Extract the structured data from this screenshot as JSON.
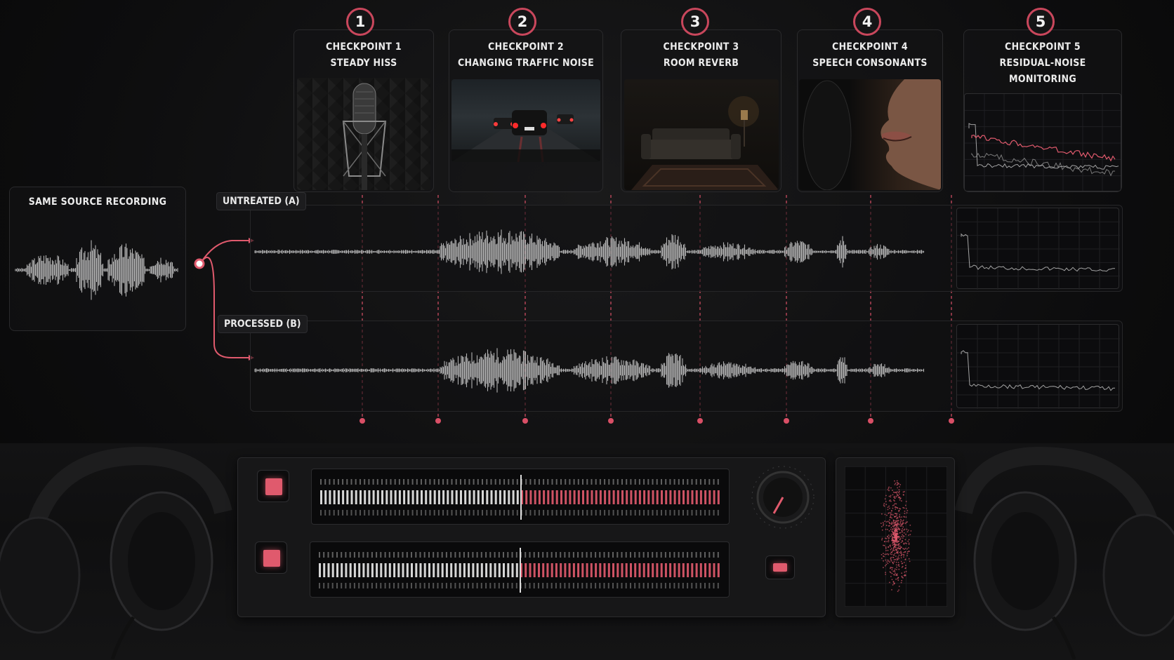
{
  "checkpoints": [
    {
      "number": "1",
      "line1": "CHECKPOINT 1",
      "line2": "STEADY HISS",
      "line3": ""
    },
    {
      "number": "2",
      "line1": "CHECKPOINT 2",
      "line2": "CHANGING TRAFFIC NOISE",
      "line3": ""
    },
    {
      "number": "3",
      "line1": "CHECKPOINT 3",
      "line2": "ROOM REVERB",
      "line3": ""
    },
    {
      "number": "4",
      "line1": "CHECKPOINT 4",
      "line2": "SPEECH CONSONANTS",
      "line3": ""
    },
    {
      "number": "5",
      "line1": "CHECKPOINT 5",
      "line2": "RESIDUAL-NOISE",
      "line3": "MONITORING"
    }
  ],
  "source": {
    "label": "SAME SOURCE RECORDING"
  },
  "lanes": {
    "untreated": "UNTREATED (A)",
    "processed": "PROCESSED (B)"
  },
  "colors": {
    "accent": "#e05a6d",
    "marker": "#d94f66",
    "waveform": "#cfcfcf",
    "background": "#0b0b0c"
  },
  "icons": [
    "microphone-icon",
    "car-traffic-icon",
    "sofa-room-icon",
    "mouth-icon",
    "spectrum-icon",
    "headphones-icon",
    "knob-icon"
  ]
}
